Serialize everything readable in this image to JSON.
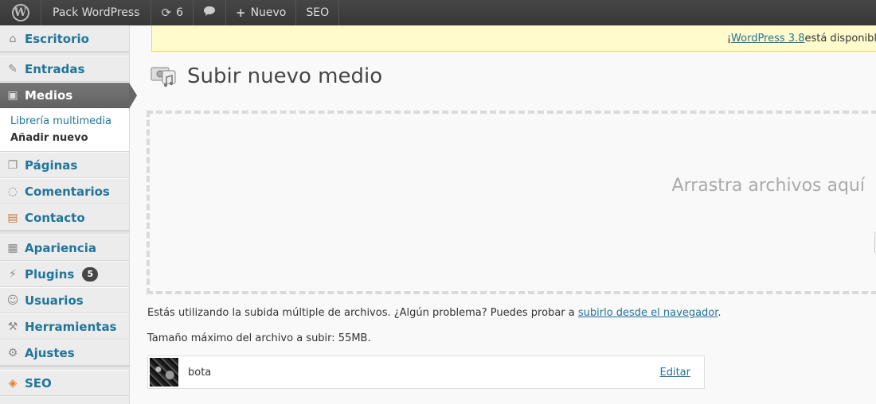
{
  "adminbar": {
    "site_name": "Pack WordPress",
    "updates_count": "6",
    "new_label": "Nuevo",
    "seo_label": "SEO"
  },
  "sidebar": {
    "items": [
      {
        "label": "Escritorio",
        "icon": "dashboard-icon"
      },
      {
        "label": "Entradas",
        "icon": "pin-icon"
      },
      {
        "label": "Medios",
        "icon": "media-icon"
      },
      {
        "label": "Páginas",
        "icon": "pages-icon"
      },
      {
        "label": "Comentarios",
        "icon": "comment-icon"
      },
      {
        "label": "Contacto",
        "icon": "contact-icon"
      },
      {
        "label": "Apariencia",
        "icon": "appearance-icon"
      },
      {
        "label": "Plugins",
        "icon": "plugin-icon",
        "badge": "5"
      },
      {
        "label": "Usuarios",
        "icon": "users-icon"
      },
      {
        "label": "Herramientas",
        "icon": "tools-icon"
      },
      {
        "label": "Ajustes",
        "icon": "settings-icon"
      },
      {
        "label": "SEO",
        "icon": "seo-icon"
      }
    ],
    "submenu": [
      {
        "label": "Librería multimedia"
      },
      {
        "label": "Añadir nuevo"
      }
    ]
  },
  "notice": {
    "prefix": "¡",
    "link": "WordPress 3.8",
    "suffix": " está disponible"
  },
  "page": {
    "title": "Subir nuevo medio",
    "drop_text": "Arrastra archivos aquí",
    "info_multi_prefix": "Estás utilizando la subida múltiple de archivos. ¿Algún problema? Puedes probar a ",
    "info_multi_link": "subirlo desde el navegador",
    "info_multi_suffix": ".",
    "max_size": "Tamaño máximo del archivo a subir: 55MB."
  },
  "media_item": {
    "filename": "bota",
    "edit_label": "Editar"
  },
  "colors": {
    "link": "#21759b",
    "adminbar": "#464646",
    "notice_bg": "#fffbcc"
  }
}
